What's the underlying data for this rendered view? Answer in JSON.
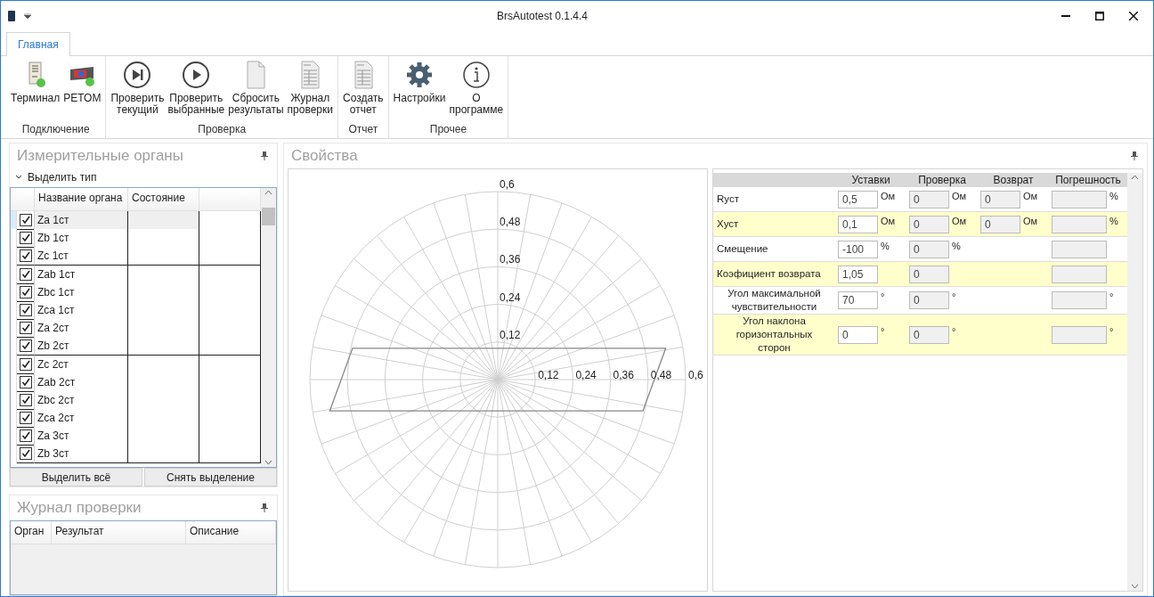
{
  "window": {
    "title": "BrsAutotest 0.1.4.4"
  },
  "ribbon_tabs": [
    {
      "label": "Главная",
      "selected": true
    }
  ],
  "ribbon_groups": [
    {
      "label": "Подключение",
      "buttons": [
        {
          "label": "Терминал",
          "kind": "terminal"
        },
        {
          "label": "РЕТОМ",
          "kind": "retom"
        }
      ]
    },
    {
      "label": "Проверка",
      "buttons": [
        {
          "label": "Проверить\nтекущий",
          "kind": "skip"
        },
        {
          "label": "Проверить\nвыбранные",
          "kind": "play"
        },
        {
          "label": "Сбросить\nрезультаты",
          "kind": "doc"
        },
        {
          "label": "Журнал\nпроверки",
          "kind": "table-doc"
        }
      ]
    },
    {
      "label": "Отчет",
      "buttons": [
        {
          "label": "Создать\nотчет",
          "kind": "table-doc"
        }
      ]
    },
    {
      "label": "Прочее",
      "buttons": [
        {
          "label": "Настройки",
          "kind": "gear"
        },
        {
          "label": "О\nпрограмме",
          "kind": "info"
        }
      ]
    }
  ],
  "organs_panel": {
    "title": "Измерительные органы",
    "filter": "Выделить тип",
    "columns": [
      "Название органа",
      "Состояние"
    ],
    "rows": [
      {
        "name": "Za 1ст",
        "checked": true,
        "selected": true
      },
      {
        "name": "Zb 1ст",
        "checked": true,
        "selected": false
      },
      {
        "name": "Zc 1ст",
        "checked": true,
        "selected": false
      },
      {
        "name": "Zab 1ст",
        "checked": true,
        "selected": false
      },
      {
        "name": "Zbc 1ст",
        "checked": true,
        "selected": false
      },
      {
        "name": "Zca 1ст",
        "checked": true,
        "selected": false
      },
      {
        "name": "Za 2ст",
        "checked": true,
        "selected": false
      },
      {
        "name": "Zb 2ст",
        "checked": true,
        "selected": false
      },
      {
        "name": "Zc 2ст",
        "checked": true,
        "selected": false
      },
      {
        "name": "Zab 2ст",
        "checked": true,
        "selected": false
      },
      {
        "name": "Zbc 2ст",
        "checked": true,
        "selected": false
      },
      {
        "name": "Zca 2ст",
        "checked": true,
        "selected": false
      },
      {
        "name": "Za 3ст",
        "checked": true,
        "selected": false
      },
      {
        "name": "Zb 3ст",
        "checked": true,
        "selected": false
      }
    ],
    "buttons": [
      "Выделить всё",
      "Снять выделение"
    ]
  },
  "journal_panel": {
    "title": "Журнал проверки",
    "columns": [
      "Орган",
      "Результат",
      "Описание"
    ]
  },
  "properties_panel": {
    "title": "Свойства",
    "polar_chart": {
      "vertical_labels": [
        "0,6",
        "0,48",
        "0,36",
        "0,24",
        "0,12"
      ],
      "horizontal_labels": [
        "0,12",
        "0,24",
        "0,36",
        "0,48",
        "0,6"
      ]
    },
    "columns": [
      "Уставки",
      "Проверка",
      "Возврат",
      "Погрешность"
    ],
    "rows": [
      {
        "label": "Rуст",
        "kind": "plain",
        "highlighted": false,
        "setting": {
          "value": "0,5",
          "unit": "Ом"
        },
        "check": {
          "value": "0",
          "unit": "Ом"
        },
        "return": {
          "value": "0",
          "unit": "Ом"
        },
        "error": {
          "unit": "%"
        }
      },
      {
        "label": "Xуст",
        "kind": "plain",
        "highlighted": true,
        "setting": {
          "value": "0,1",
          "unit": "Ом"
        },
        "check": {
          "value": "0",
          "unit": "Ом"
        },
        "return": {
          "value": "0",
          "unit": "Ом"
        },
        "error": {
          "unit": "%"
        }
      },
      {
        "label": "Смещение",
        "kind": "plain",
        "highlighted": false,
        "setting": {
          "value": "-100",
          "unit": "%"
        },
        "check": {
          "value": "0",
          "unit": "%"
        },
        "error": {}
      },
      {
        "label": "Коэфициент возврата",
        "kind": "plain",
        "highlighted": true,
        "setting": {
          "value": "1,05"
        },
        "check": {
          "value": "0"
        },
        "error": {}
      },
      {
        "label": "Угол максимальной чувствительности",
        "kind": "centered",
        "highlighted": false,
        "setting": {
          "value": "70",
          "unit": "°"
        },
        "check": {
          "value": "0",
          "unit": "°"
        },
        "error": {
          "unit": "°"
        }
      },
      {
        "label": "Угол наклона горизонтальных сторон",
        "kind": "centered",
        "highlighted": true,
        "setting": {
          "value": "0",
          "unit": "°"
        },
        "check": {
          "value": "0",
          "unit": "°"
        },
        "error": {
          "unit": "°"
        }
      }
    ]
  }
}
